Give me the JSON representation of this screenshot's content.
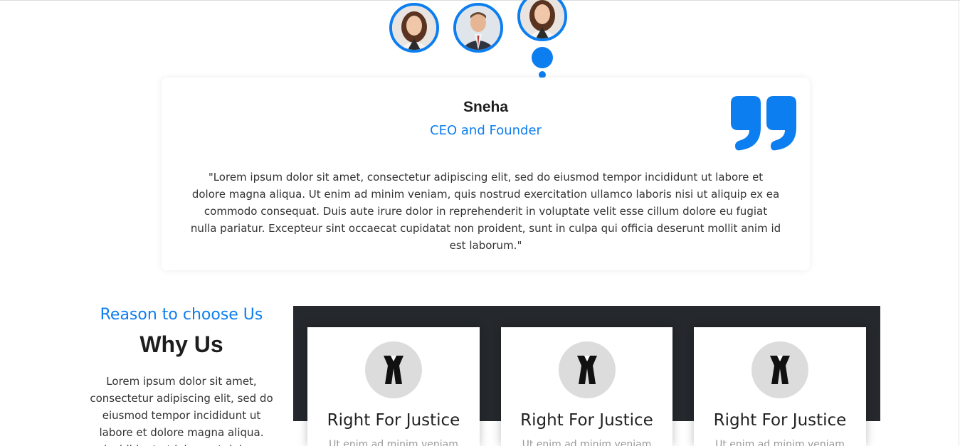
{
  "testimonial": {
    "name": "Sneha",
    "role": "CEO and Founder",
    "quote": "\"Lorem ipsum dolor sit amet, consectetur adipiscing elit, sed do eiusmod tempor incididunt ut labore et dolore magna aliqua. Ut enim ad minim veniam, quis nostrud exercitation ullamco laboris nisi ut aliquip ex ea commodo consequat. Duis aute irure dolor in reprehenderit in voluptate velit esse cillum dolore eu fugiat nulla pariatur. Excepteur sint occaecat cupidatat non proident, sunt in culpa qui officia deserunt mollit anim id est laborum.\"",
    "avatars": [
      "woman-avatar",
      "man-avatar",
      "woman-avatar"
    ]
  },
  "why_us": {
    "kicker": "Reason to choose Us",
    "heading": "Why Us",
    "text": "Lorem ipsum dolor sit amet, consectetur adipiscing elit, sed do eiusmod tempor incididunt ut labore et dolore magna aliqua. incididunt ut labore et dolore"
  },
  "features": [
    {
      "title": "Right For Justice",
      "subtitle": "Ut enim ad minim veniam",
      "icon": "lawyer-robe-icon"
    },
    {
      "title": "Right For Justice",
      "subtitle": "Ut enim ad minim veniam",
      "icon": "lawyer-robe-icon"
    },
    {
      "title": "Right For Justice",
      "subtitle": "Ut enim ad minim veniam",
      "icon": "lawyer-robe-icon"
    }
  ],
  "colors": {
    "accent": "#0d7ef0",
    "dark_band": "#25282c",
    "icon_bg": "#dcdcdc"
  }
}
